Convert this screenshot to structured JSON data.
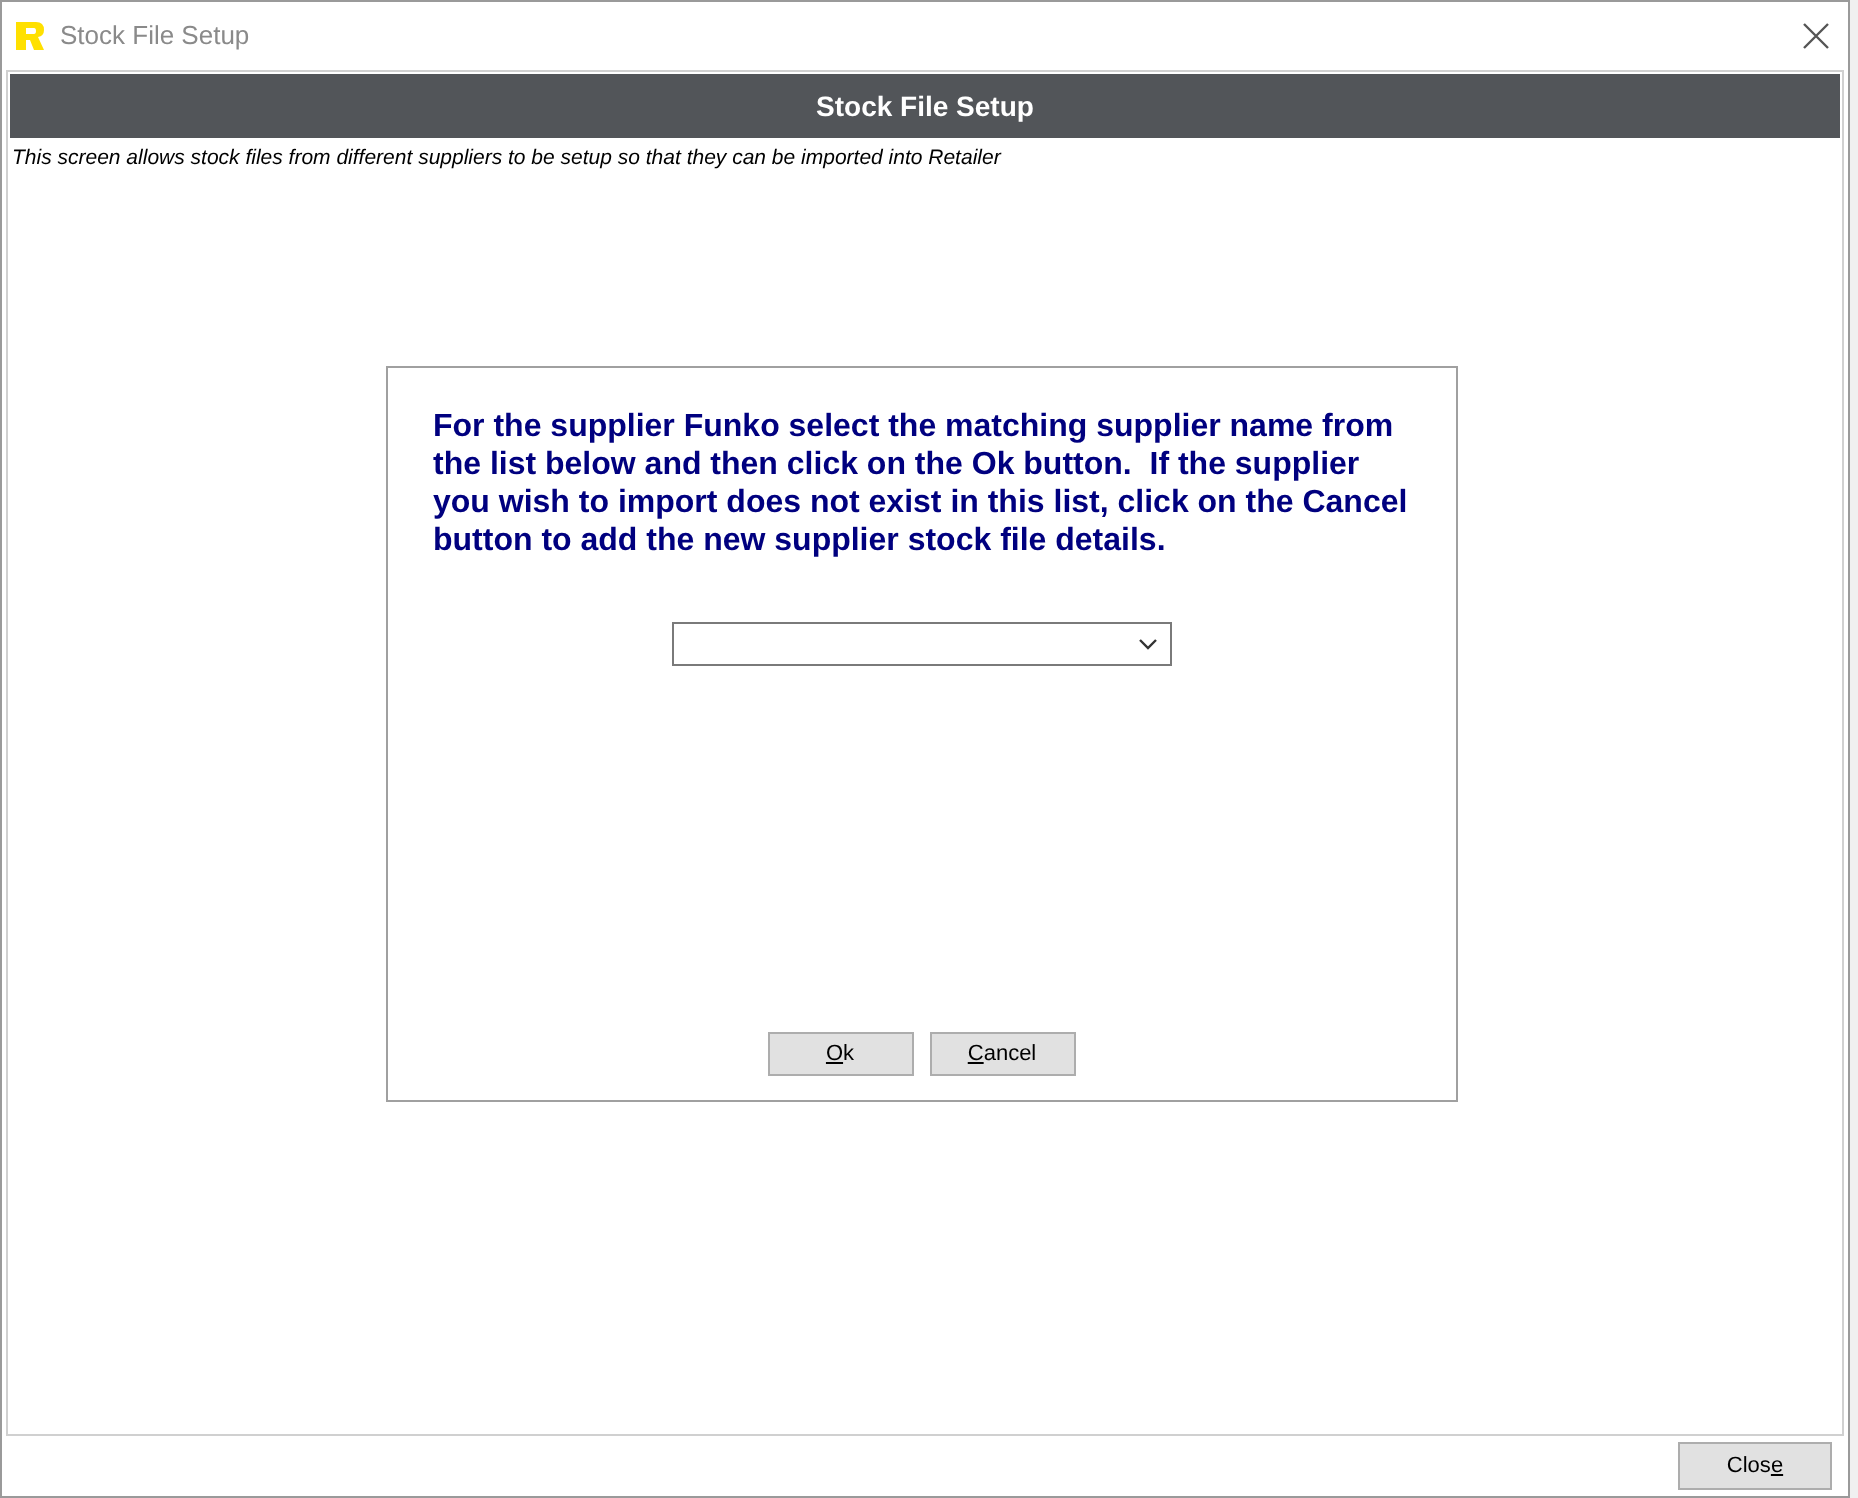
{
  "window": {
    "title": "Stock File Setup"
  },
  "header": {
    "title": "Stock File Setup",
    "description": "This screen allows stock files from different suppliers to be setup so that they can be imported into Retailer"
  },
  "dialog": {
    "message": "For the supplier Funko select the matching supplier name from the list below and then click on the Ok button.  If the supplier you wish to import does not exist in this list, click on the Cancel button to add the new supplier stock file details.",
    "buttons": [
      [
        {
          "text": "O",
          "underlined": true
        },
        {
          "text": "k",
          "underlined": false
        }
      ],
      [
        {
          "text": "C",
          "underlined": true
        },
        {
          "text": "ancel",
          "underlined": false
        }
      ]
    ]
  },
  "footer": {
    "close_button": [
      {
        "text": "Clos",
        "underlined": false
      },
      {
        "text": "e",
        "underlined": true
      }
    ]
  }
}
